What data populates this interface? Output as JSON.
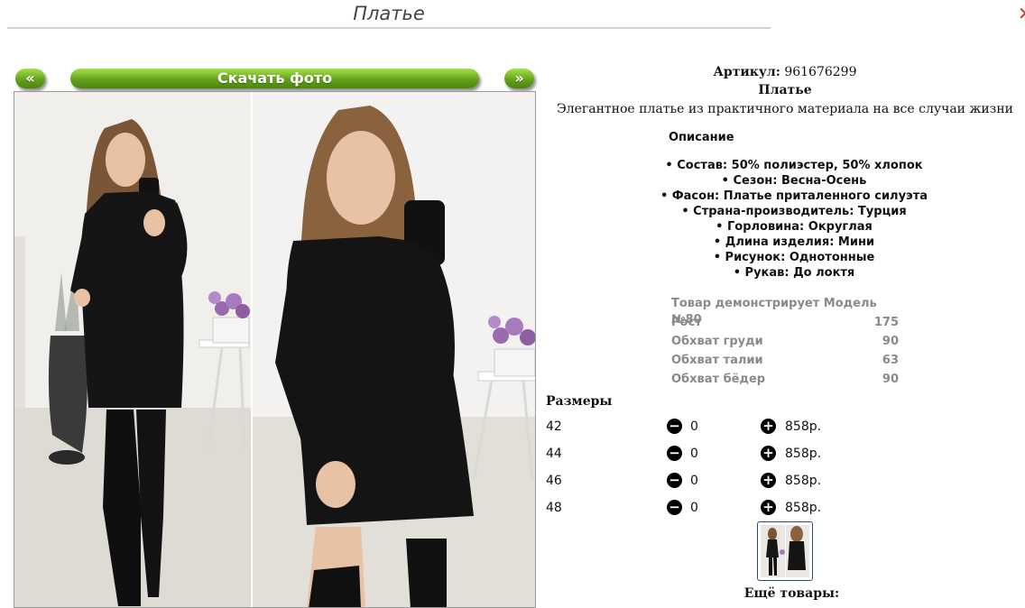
{
  "header": {
    "title": "Платье"
  },
  "gallery": {
    "prev_label": "«",
    "download_label": "Скачать фото",
    "next_label": "»"
  },
  "product": {
    "sku_label": "Артикул:",
    "sku_value": "961676299",
    "name": "Платье",
    "tagline": "Элегантное платье из практичного материала на все случаи жизни"
  },
  "description": {
    "heading": "Описание",
    "features": [
      "• Состав: 50% полиэстер, 50% хлопок",
      "• Сезон: Весна-Осень",
      "• Фасон: Платье приталенного силуэта",
      "• Страна-производитель: Турция",
      "• Горловина: Округлая",
      "• Длина изделия: Мини",
      "• Рисунок: Однотонные",
      "• Рукав: До локтя"
    ]
  },
  "model": {
    "rows": [
      {
        "label": "Товар демонстрирует Модель №80",
        "value": ""
      },
      {
        "label": "Рост",
        "value": "175"
      },
      {
        "label": "Обхват груди",
        "value": "90"
      },
      {
        "label": "Обхват талии",
        "value": "63"
      },
      {
        "label": "Обхват бёдер",
        "value": "90"
      }
    ]
  },
  "sizes": {
    "heading": "Размеры",
    "minus_glyph": "−",
    "plus_glyph": "+",
    "rows": [
      {
        "size": "42",
        "qty": "0",
        "price": "858р."
      },
      {
        "size": "44",
        "qty": "0",
        "price": "858р."
      },
      {
        "size": "46",
        "qty": "0",
        "price": "858р."
      },
      {
        "size": "48",
        "qty": "0",
        "price": "858р."
      }
    ]
  },
  "more": {
    "heading": "Ещё товары:"
  },
  "colors": {
    "button_green": "#5f9e18",
    "model_gray": "#8a8a8a",
    "close_red": "#c0392b",
    "dress_black": "#151515"
  },
  "icons": [
    "close-icon",
    "minus-circle-icon",
    "plus-circle-icon"
  ]
}
